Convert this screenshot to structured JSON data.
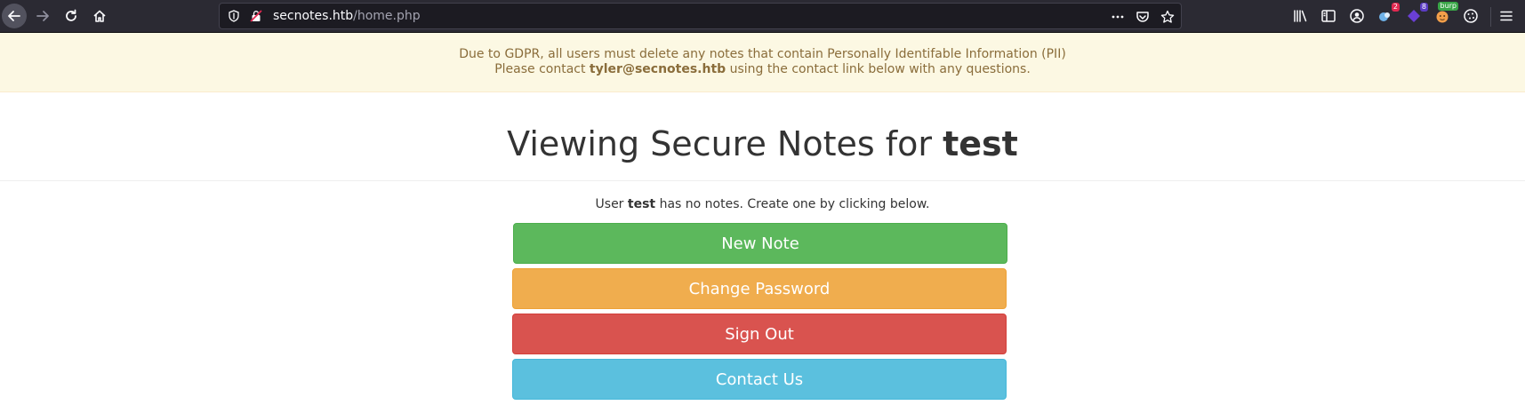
{
  "browser": {
    "url_host": "secnotes.htb",
    "url_path": "/home.php",
    "extension_badges": {
      "ext1": "2",
      "ext2": "8",
      "burp": "burp"
    }
  },
  "alert": {
    "line1": "Due to GDPR, all users must delete any notes that contain Personally Identifable Information (PII)",
    "line2_prefix": "Please contact ",
    "line2_email": "tyler@secnotes.htb",
    "line2_suffix": " using the contact link below with any questions."
  },
  "heading": {
    "prefix": "Viewing Secure Notes for ",
    "username": "test"
  },
  "notes": {
    "prefix": "User ",
    "username": "test",
    "suffix": " has no notes. Create one by clicking below."
  },
  "buttons": {
    "new_note": "New Note",
    "change_password": "Change Password",
    "sign_out": "Sign Out",
    "contact_us": "Contact Us"
  },
  "colors": {
    "success": "#5cb85c",
    "warning": "#f0ad4e",
    "danger": "#d9534f",
    "info": "#5bc0de",
    "alert_bg": "#fcf8e3",
    "alert_text": "#8a6d3b"
  }
}
